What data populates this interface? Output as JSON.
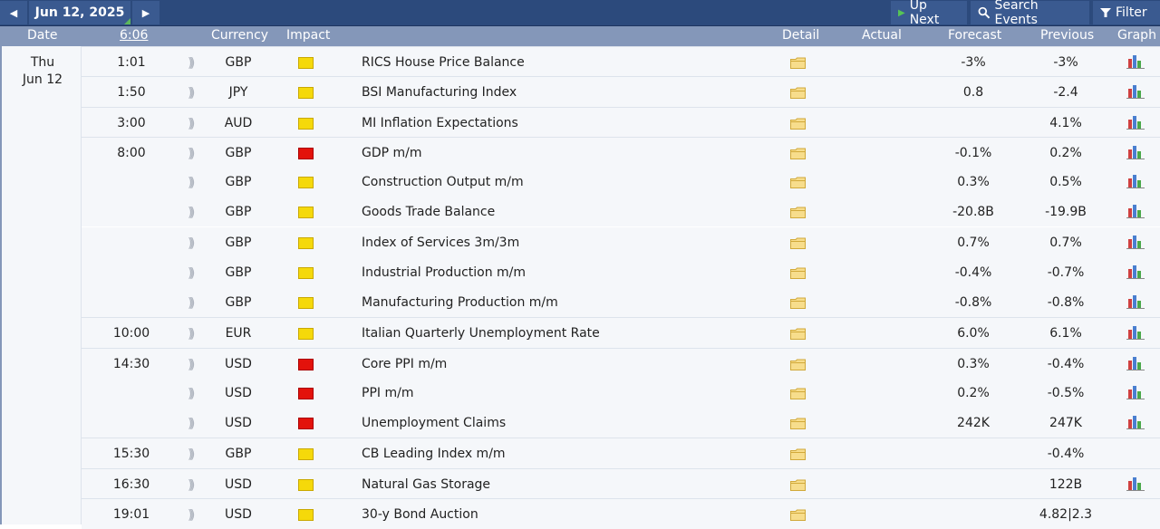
{
  "toolbar": {
    "date": "Jun 12, 2025",
    "up_next": "Up Next",
    "search_events": "Search Events",
    "filter": "Filter"
  },
  "header": {
    "date": "Date",
    "time": "6:06",
    "currency": "Currency",
    "impact": "Impact",
    "detail": "Detail",
    "actual": "Actual",
    "forecast": "Forecast",
    "previous": "Previous",
    "graph": "Graph"
  },
  "day": {
    "weekday": "Thu",
    "date": "Jun 12"
  },
  "colors": {
    "toolbar": "#2c4a7c",
    "header": "#8497b9",
    "impact_medium": "#f5d90a",
    "impact_high": "#e3120b"
  },
  "events": [
    {
      "time": "1:01",
      "currency": "GBP",
      "impact": "medium",
      "event": "RICS House Price Balance",
      "forecast": "-3%",
      "previous": "-3%",
      "graph": true
    },
    {
      "time": "1:50",
      "currency": "JPY",
      "impact": "medium",
      "event": "BSI Manufacturing Index",
      "forecast": "0.8",
      "previous": "-2.4",
      "graph": true
    },
    {
      "time": "3:00",
      "currency": "AUD",
      "impact": "medium",
      "event": "MI Inflation Expectations",
      "forecast": "",
      "previous": "4.1%",
      "graph": true
    },
    {
      "time": "8:00",
      "currency": "GBP",
      "impact": "high",
      "event": "GDP m/m",
      "forecast": "-0.1%",
      "previous": "0.2%",
      "graph": true
    },
    {
      "time": "",
      "currency": "GBP",
      "impact": "medium",
      "event": "Construction Output m/m",
      "forecast": "0.3%",
      "previous": "0.5%",
      "graph": true
    },
    {
      "time": "",
      "currency": "GBP",
      "impact": "medium",
      "event": "Goods Trade Balance",
      "forecast": "-20.8B",
      "previous": "-19.9B",
      "graph": true
    },
    {
      "time": "",
      "currency": "GBP",
      "impact": "medium",
      "event": "Index of Services 3m/3m",
      "forecast": "0.7%",
      "previous": "0.7%",
      "graph": true
    },
    {
      "time": "",
      "currency": "GBP",
      "impact": "medium",
      "event": "Industrial Production m/m",
      "forecast": "-0.4%",
      "previous": "-0.7%",
      "graph": true
    },
    {
      "time": "",
      "currency": "GBP",
      "impact": "medium",
      "event": "Manufacturing Production m/m",
      "forecast": "-0.8%",
      "previous": "-0.8%",
      "graph": true
    },
    {
      "time": "10:00",
      "currency": "EUR",
      "impact": "medium",
      "event": "Italian Quarterly Unemployment Rate",
      "forecast": "6.0%",
      "previous": "6.1%",
      "graph": true
    },
    {
      "time": "14:30",
      "currency": "USD",
      "impact": "high",
      "event": "Core PPI m/m",
      "forecast": "0.3%",
      "previous": "-0.4%",
      "graph": true
    },
    {
      "time": "",
      "currency": "USD",
      "impact": "high",
      "event": "PPI m/m",
      "forecast": "0.2%",
      "previous": "-0.5%",
      "graph": true
    },
    {
      "time": "",
      "currency": "USD",
      "impact": "high",
      "event": "Unemployment Claims",
      "forecast": "242K",
      "previous": "247K",
      "graph": true
    },
    {
      "time": "15:30",
      "currency": "GBP",
      "impact": "medium",
      "event": "CB Leading Index m/m",
      "forecast": "",
      "previous": "-0.4%",
      "graph": false
    },
    {
      "time": "16:30",
      "currency": "USD",
      "impact": "medium",
      "event": "Natural Gas Storage",
      "forecast": "",
      "previous": "122B",
      "graph": true
    },
    {
      "time": "19:01",
      "currency": "USD",
      "impact": "medium",
      "event": "30-y Bond Auction",
      "forecast": "",
      "previous": "4.82|2.3",
      "graph": false
    }
  ]
}
